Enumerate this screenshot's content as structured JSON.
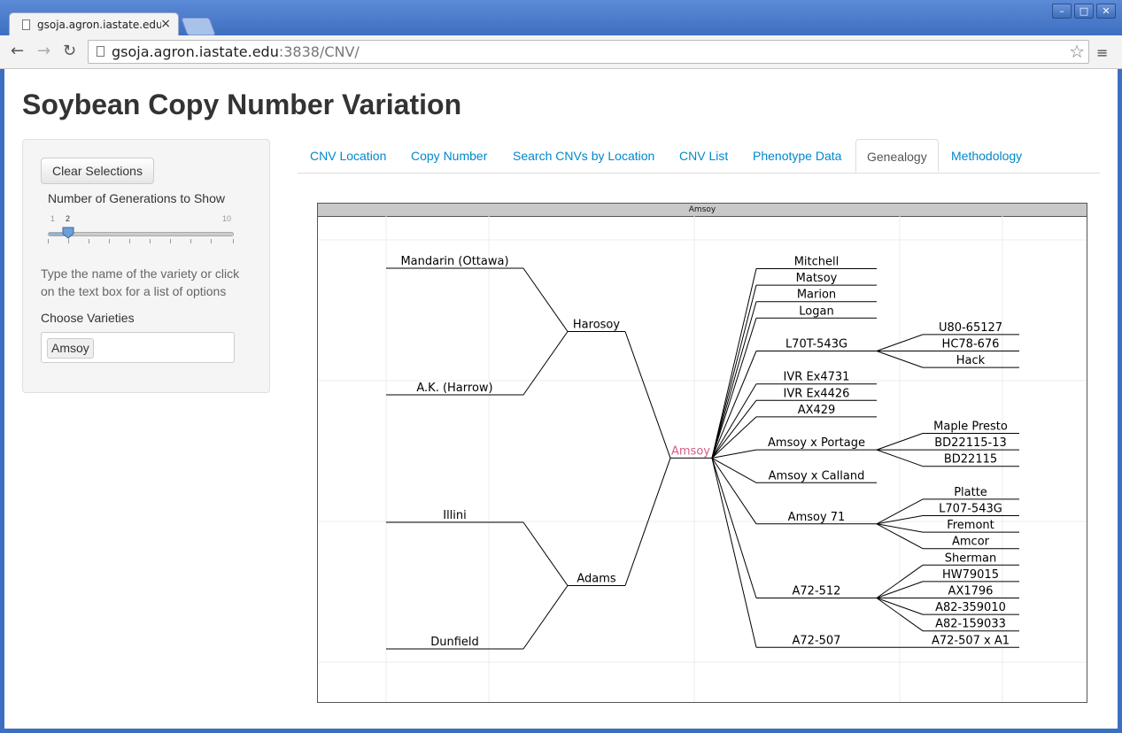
{
  "browser": {
    "tab_title": "gsoja.agron.iastate.edu:3838/CNV/",
    "tab_close": "×",
    "url_host": "gsoja.agron.iastate.edu",
    "url_rest": ":3838/CNV/",
    "back": "←",
    "forward": "→",
    "reload": "↻",
    "star": "☆",
    "menu": "≡",
    "minimize": "–",
    "maximize": "□",
    "close": "✕"
  },
  "app": {
    "title": "Soybean Copy Number Variation"
  },
  "sidebar": {
    "clear_button": "Clear Selections",
    "generations_label": "Number of Generations to Show",
    "slider": {
      "min": 1,
      "max": 10,
      "value": 2,
      "min_label": "1",
      "max_label": "10",
      "value_label": "2"
    },
    "help_text": "Type the name of the variety or click on the text box for a list of options",
    "choose_label": "Choose Varieties",
    "selected_variety": "Amsoy"
  },
  "tabs": [
    {
      "label": "CNV Location",
      "active": false
    },
    {
      "label": "Copy Number",
      "active": false
    },
    {
      "label": "Search CNVs by Location",
      "active": false
    },
    {
      "label": "CNV List",
      "active": false
    },
    {
      "label": "Phenotype Data",
      "active": false
    },
    {
      "label": "Genealogy",
      "active": true
    },
    {
      "label": "Methodology",
      "active": false
    }
  ],
  "chart_data": {
    "type": "tree",
    "panel_title": "Amsoy",
    "root": "Amsoy",
    "root_color": "#d1608a",
    "parents": [
      {
        "name": "Harosoy",
        "parents": [
          "Mandarin (Ottawa)",
          "A.K. (Harrow)"
        ]
      },
      {
        "name": "Adams",
        "parents": [
          "Illini",
          "Dunfield"
        ]
      }
    ],
    "descendants": [
      {
        "name": "Mitchell",
        "children": []
      },
      {
        "name": "Matsoy",
        "children": []
      },
      {
        "name": "Marion",
        "children": []
      },
      {
        "name": "Logan",
        "children": []
      },
      {
        "name": "L70T-543G",
        "children": [
          "U80-65127",
          "HC78-676",
          "Hack"
        ]
      },
      {
        "name": "IVR Ex4731",
        "children": []
      },
      {
        "name": "IVR Ex4426",
        "children": []
      },
      {
        "name": "AX429",
        "children": []
      },
      {
        "name": "Amsoy x Portage",
        "children": [
          "Maple Presto",
          "BD22115-13",
          "BD22115"
        ]
      },
      {
        "name": "Amsoy x Calland",
        "children": []
      },
      {
        "name": "Amsoy 71",
        "children": [
          "Platte",
          "L707-543G",
          "Fremont",
          "Amcor"
        ]
      },
      {
        "name": "A72-512",
        "children": [
          "Sherman",
          "HW79015",
          "AX1796",
          "A82-359010",
          "A82-159033"
        ]
      },
      {
        "name": "A72-507",
        "children": [
          "A72-507 x A1"
        ]
      }
    ]
  }
}
